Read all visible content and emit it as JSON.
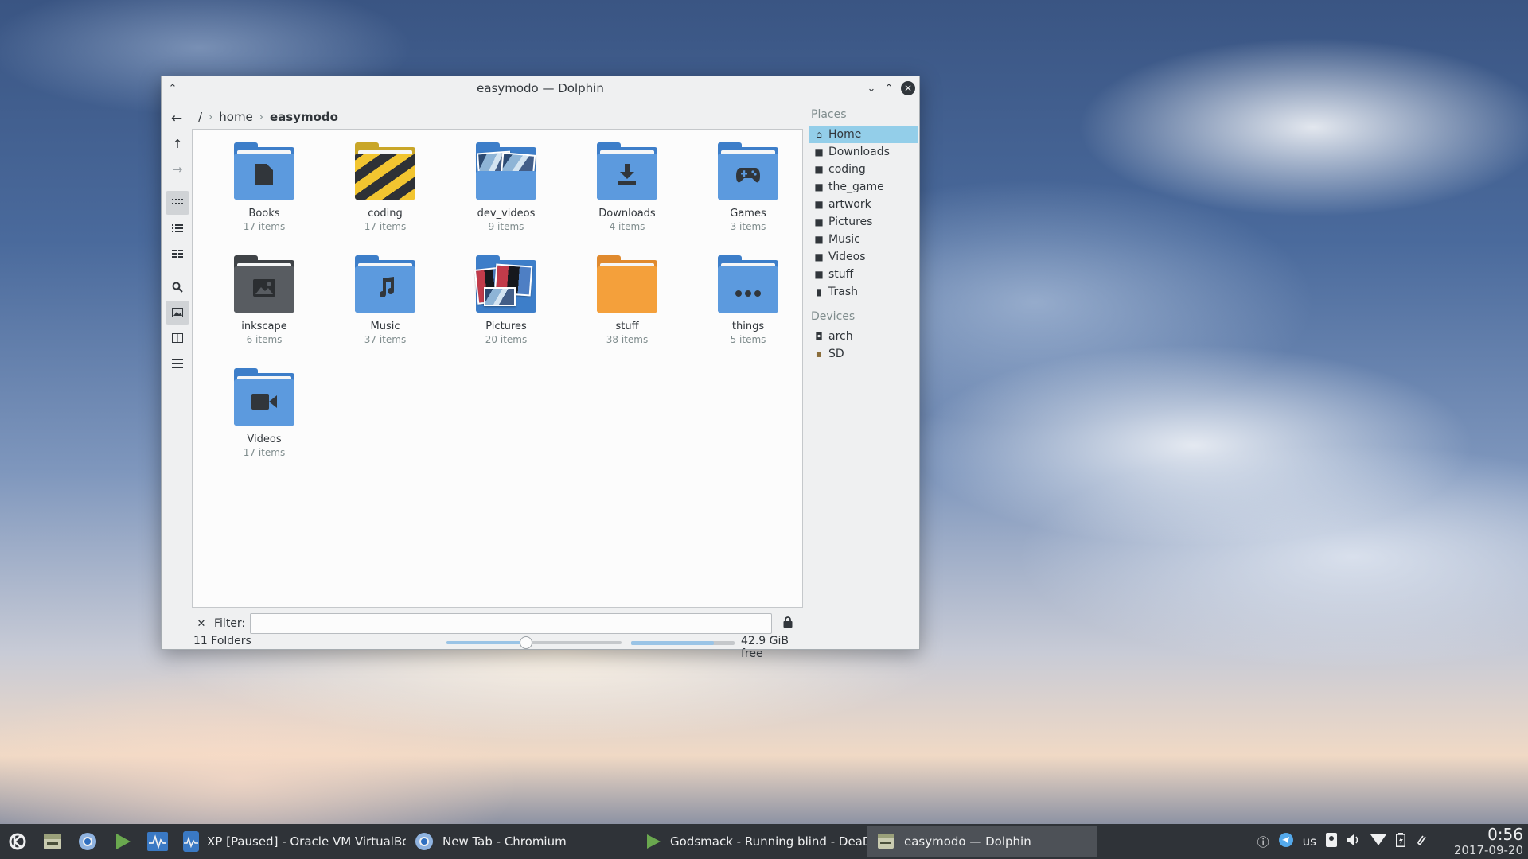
{
  "window": {
    "title": "easymodo — Dolphin",
    "buttons": {
      "shade": "⌃",
      "minimize": "⌄",
      "maximize": "⌃",
      "close": "✕"
    }
  },
  "breadcrumb": {
    "root": "/",
    "items": [
      "home",
      "easymodo"
    ]
  },
  "folders": [
    {
      "name": "Books",
      "count": "17 items",
      "color": "#5c9ade",
      "icon": "document-icon"
    },
    {
      "name": "coding",
      "count": "17 items",
      "color": "#f2c530",
      "icon": "hazard-stripes-icon"
    },
    {
      "name": "dev_videos",
      "count": "9 items",
      "color": "#5c9ade",
      "icon": "photo-preview-icon"
    },
    {
      "name": "Downloads",
      "count": "4 items",
      "color": "#5c9ade",
      "icon": "download-icon"
    },
    {
      "name": "Games",
      "count": "3 items",
      "color": "#5c9ade",
      "icon": "gamepad-icon"
    },
    {
      "name": "inkscape",
      "count": "6 items",
      "color": "#585c61",
      "icon": "image-icon"
    },
    {
      "name": "Music",
      "count": "37 items",
      "color": "#5c9ade",
      "icon": "music-note-icon"
    },
    {
      "name": "Pictures",
      "count": "20 items",
      "color": "#5c9ade",
      "icon": "photo-preview-icon"
    },
    {
      "name": "stuff",
      "count": "38 items",
      "color": "#f4a03b",
      "icon": "folder-plain-icon"
    },
    {
      "name": "things",
      "count": "5 items",
      "color": "#5c9ade",
      "icon": "ellipsis-icon"
    },
    {
      "name": "Videos",
      "count": "17 items",
      "color": "#5c9ade",
      "icon": "video-camera-icon"
    }
  ],
  "filter": {
    "label": "Filter:",
    "value": "",
    "placeholder": ""
  },
  "status": {
    "text": "11 Folders",
    "zoom_level": 0.45,
    "space_used_fraction": 0.8,
    "free_space": "42.9 GiB free"
  },
  "places": {
    "heading": "Places",
    "items": [
      {
        "label": "Home",
        "icon": "home-icon",
        "active": true
      },
      {
        "label": "Downloads",
        "icon": "folder-icon"
      },
      {
        "label": "coding",
        "icon": "folder-icon"
      },
      {
        "label": "the_game",
        "icon": "folder-icon"
      },
      {
        "label": "artwork",
        "icon": "folder-icon"
      },
      {
        "label": "Pictures",
        "icon": "folder-icon"
      },
      {
        "label": "Music",
        "icon": "folder-icon"
      },
      {
        "label": "Videos",
        "icon": "folder-icon"
      },
      {
        "label": "stuff",
        "icon": "folder-icon"
      },
      {
        "label": "Trash",
        "icon": "trash-icon"
      }
    ],
    "devices_heading": "Devices",
    "devices": [
      {
        "label": "arch",
        "icon": "drive-icon"
      },
      {
        "label": "SD",
        "icon": "sd-card-icon"
      }
    ]
  },
  "taskbar": {
    "tasks": [
      {
        "label": "XP [Paused] - Oracle VM VirtualBox",
        "icon": "virtualbox-icon"
      },
      {
        "label": "New Tab - Chromium",
        "icon": "chromium-icon"
      },
      {
        "label": "Godsmack - Running blind - DeaD...",
        "icon": "media-player-icon"
      },
      {
        "label": "easymodo — Dolphin",
        "icon": "dolphin-icon",
        "active": true
      }
    ],
    "tray": {
      "keyboard_layout": "us"
    },
    "clock": {
      "time": "0:56",
      "date": "2017-09-20"
    }
  }
}
